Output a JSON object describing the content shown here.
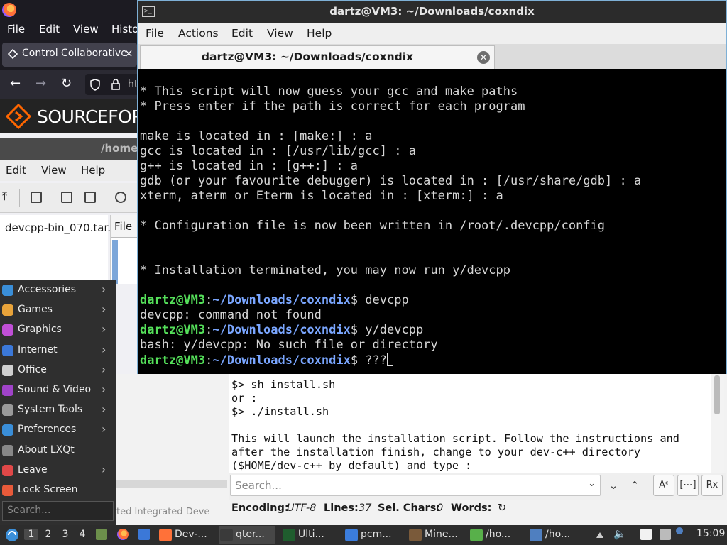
{
  "firefox": {
    "menu": [
      "File",
      "Edit",
      "View",
      "Histo"
    ],
    "tab_title": "Control Collaborative",
    "tab_close": "×",
    "url_fragment": "htt",
    "sourceforge_logo_text": "SOURCEFOR"
  },
  "file_manager": {
    "title_fragment": "/home",
    "menu": [
      "Edit",
      "View",
      "Help"
    ],
    "left_item": "devcpp-bin_070.tar.",
    "column_header": "File"
  },
  "start_menu": {
    "items": [
      {
        "label": "Accessories",
        "icon": "accessories-icon",
        "color": "#3a8ed8",
        "submenu": true
      },
      {
        "label": "Games",
        "icon": "games-icon",
        "color": "#e8a33a",
        "submenu": true
      },
      {
        "label": "Graphics",
        "icon": "graphics-icon",
        "color": "#c04fd6",
        "submenu": true
      },
      {
        "label": "Internet",
        "icon": "internet-icon",
        "color": "#3b78d8",
        "submenu": true
      },
      {
        "label": "Office",
        "icon": "office-icon",
        "color": "#cfcfcf",
        "submenu": true
      },
      {
        "label": "Sound & Video",
        "icon": "sound-video-icon",
        "color": "#a043c9",
        "submenu": true
      },
      {
        "label": "System Tools",
        "icon": "system-tools-icon",
        "color": "#9a9a9a",
        "submenu": true
      },
      {
        "label": "Preferences",
        "icon": "preferences-icon",
        "color": "#3a8ed8",
        "submenu": true
      },
      {
        "label": "About LXQt",
        "icon": "about-icon",
        "color": "#888888",
        "submenu": false
      },
      {
        "label": "Leave",
        "icon": "leave-icon",
        "color": "#e04848",
        "submenu": true
      },
      {
        "label": "Lock Screen",
        "icon": "lock-icon",
        "color": "#e85a3a",
        "submenu": false
      }
    ],
    "arrow": "›",
    "search_placeholder": "Search..."
  },
  "editor": {
    "left_fragment": "ted Integrated Deve",
    "text": "$> sh install.sh\nor :\n$> ./install.sh\n\nThis will launch the installation script. Follow the instructions and\nafter the installation finish, change to your dev-c++ directory\n($HOME/dev-c++ by default) and type :",
    "search_placeholder": "Search...",
    "find_down": "⌄",
    "find_up": "⌃",
    "match_case": "Aᶜ",
    "whole_word": "[⋯]",
    "regex": "Rx",
    "status": {
      "encoding_label": "Encoding:",
      "encoding_value": "UTF-8",
      "lines_label": "Lines:",
      "lines_value": "37",
      "sel_label": "Sel. Chars:",
      "sel_value": "0",
      "words_label": "Words:",
      "refresh": "↻"
    }
  },
  "terminal": {
    "window_title": "dartz@VM3: ~/Downloads/coxndix",
    "menu": [
      "File",
      "Actions",
      "Edit",
      "View",
      "Help"
    ],
    "tab_title": "dartz@VM3: ~/Downloads/coxndix",
    "tab_close": "✕",
    "lines": [
      "* This script will now guess your gcc and make paths",
      "* Press enter if the path is correct for each program",
      "",
      "make is located in : [make:] : a",
      "gcc is located in : [/usr/lib/gcc] : a",
      "g++ is located in : [g++:] : a",
      "gdb (or your favourite debugger) is located in : [/usr/share/gdb] : a",
      "xterm, aterm or Eterm is located in : [xterm:] : a",
      "",
      "* Configuration file is now been written in /root/.devcpp/config",
      "",
      "",
      "* Installation terminated, you may now run y/devcpp",
      ""
    ],
    "prompt_user": "dartz@VM3",
    "prompt_sep": ":",
    "prompt_path": "~/Downloads/coxndix",
    "prompt_end": "$ ",
    "session": [
      {
        "type": "cmd",
        "text": "devcpp"
      },
      {
        "type": "out",
        "text": "devcpp: command not found"
      },
      {
        "type": "cmd",
        "text": "y/devcpp"
      },
      {
        "type": "out",
        "text": "bash: y/devcpp: No such file or directory"
      },
      {
        "type": "cmd",
        "text": "???"
      }
    ]
  },
  "taskbar": {
    "desktops": [
      "1",
      "2",
      "3",
      "4"
    ],
    "tasks": [
      {
        "label": "Dev-...",
        "icon": "firefox-icon",
        "color": "#ff7139"
      },
      {
        "label": "qter...",
        "icon": "terminal-icon",
        "color": "#3a3a3a"
      },
      {
        "label": "Ulti...",
        "icon": "ultimate-icon",
        "color": "#1f5d2e"
      },
      {
        "label": "pcm...",
        "icon": "folder-icon",
        "color": "#3b7ddd"
      },
      {
        "label": "Mine...",
        "icon": "minecraft-icon",
        "color": "#7a5a3a"
      },
      {
        "label": "/ho...",
        "icon": "file-icon",
        "color": "#58b04a"
      },
      {
        "label": "/ho...",
        "icon": "editor-icon",
        "color": "#4f7fc0"
      }
    ],
    "clock": "15:09"
  }
}
